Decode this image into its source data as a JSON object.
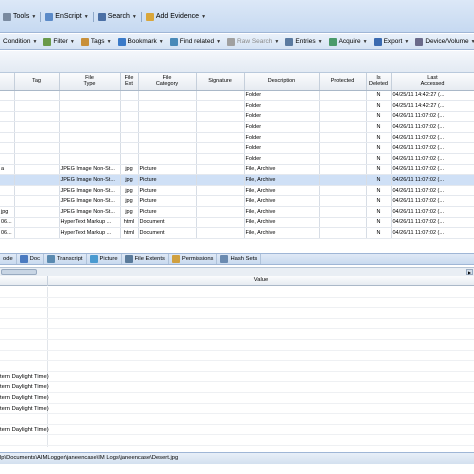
{
  "menubar": {
    "items": [
      {
        "label": "Tools",
        "icon": "tools-icon"
      },
      {
        "label": "EnScript",
        "icon": "enscript-icon"
      },
      {
        "label": "Search",
        "icon": "search-icon"
      },
      {
        "label": "Add Evidence",
        "icon": "add-evidence-icon"
      }
    ]
  },
  "toolbar": {
    "items": [
      {
        "label": "Condition",
        "icon": ""
      },
      {
        "label": "Filter",
        "icon": "filter-icon"
      },
      {
        "label": "Tags",
        "icon": "tag-icon"
      },
      {
        "label": "Bookmark",
        "icon": "bookmark-icon"
      },
      {
        "label": "Find related",
        "icon": "find-related-icon"
      },
      {
        "label": "Raw Search",
        "icon": "raw-search-icon"
      },
      {
        "label": "Entries",
        "icon": "entries-icon"
      },
      {
        "label": "Acquire",
        "icon": "acquire-icon"
      },
      {
        "label": "Export",
        "icon": "export-icon"
      },
      {
        "label": "Device/Volume",
        "icon": "device-volume-icon"
      }
    ]
  },
  "table": {
    "headers": [
      "",
      "Tag",
      "File\nType",
      "File\nExt",
      "File\nCategory",
      "Signature",
      "Description",
      "Protected",
      "Is\nDeleted",
      "Last\nAccessed"
    ],
    "rows": [
      [
        "",
        "",
        "",
        "",
        "",
        "",
        "Folder",
        "",
        "N",
        "04/25/11 14:42:27 (..."
      ],
      [
        "",
        "",
        "",
        "",
        "",
        "",
        "Folder",
        "",
        "N",
        "04/25/11 14:42:27 (..."
      ],
      [
        "",
        "",
        "",
        "",
        "",
        "",
        "Folder",
        "",
        "N",
        "04/26/11 11:07:02 (..."
      ],
      [
        "",
        "",
        "",
        "",
        "",
        "",
        "Folder",
        "",
        "N",
        "04/26/11 11:07:02 (..."
      ],
      [
        "",
        "",
        "",
        "",
        "",
        "",
        "Folder",
        "",
        "N",
        "04/26/11 11:07:02 (..."
      ],
      [
        "",
        "",
        "",
        "",
        "",
        "",
        "Folder",
        "",
        "N",
        "04/26/11 11:07:02 (..."
      ],
      [
        "",
        "",
        "",
        "",
        "",
        "",
        "Folder",
        "",
        "N",
        "04/26/11 11:07:02 (..."
      ],
      [
        "a",
        "",
        "JPEG Image Non-St...",
        "jpg",
        "Picture",
        "",
        "File, Archive",
        "",
        "N",
        "04/26/11 11:07:02 (..."
      ],
      [
        "",
        "",
        "JPEG Image Non-St...",
        "jpg",
        "Picture",
        "",
        "File, Archive",
        "",
        "N",
        "04/26/11 11:07:02 (..."
      ],
      [
        "",
        "",
        "JPEG Image Non-St...",
        "jpg",
        "Picture",
        "",
        "File, Archive",
        "",
        "N",
        "04/26/11 11:07:02 (..."
      ],
      [
        "",
        "",
        "JPEG Image Non-St...",
        "jpg",
        "Picture",
        "",
        "File, Archive",
        "",
        "N",
        "04/26/11 11:07:02 (..."
      ],
      [
        "jpg",
        "",
        "JPEG Image Non-St...",
        "jpg",
        "Picture",
        "",
        "File, Archive",
        "",
        "N",
        "04/26/11 11:07:02 (..."
      ],
      [
        "06...",
        "",
        "HyperText Markup ...",
        "html",
        "Document",
        "",
        "File, Archive",
        "",
        "N",
        "04/26/11 11:07:02 (..."
      ],
      [
        "06...",
        "",
        "HyperText Markup ...",
        "html",
        "Document",
        "",
        "File, Archive",
        "",
        "N",
        "04/26/11 11:07:02 (..."
      ]
    ],
    "selected_row": 8
  },
  "tabs": [
    {
      "label": "ode",
      "icon": ""
    },
    {
      "label": "Doc",
      "icon": "doc-icon"
    },
    {
      "label": "Transcript",
      "icon": "transcript-icon"
    },
    {
      "label": "Picture",
      "icon": "picture-icon"
    },
    {
      "label": "File Extents",
      "icon": "file-extents-icon"
    },
    {
      "label": "Permissions",
      "icon": "permissions-icon"
    },
    {
      "label": "Hash Sets",
      "icon": "hash-sets-icon"
    }
  ],
  "properties": {
    "value_header": "Value",
    "rows": [
      "",
      "",
      "",
      "",
      "",
      "",
      "",
      "",
      "tern Daylight Time)",
      "tern Daylight Time)",
      "tern Daylight Time)",
      "tern Daylight Time)",
      "",
      "tern Daylight Time)",
      ""
    ]
  },
  "statusbar": {
    "path": "lp\\Documents\\AIMLogger\\janeencase\\IM Logs\\janeencase\\Desert.jpg"
  },
  "colors": {
    "menubar_bg": "#c6d9f1",
    "selection": "#cfe0f6",
    "border": "#9fb6d6"
  }
}
